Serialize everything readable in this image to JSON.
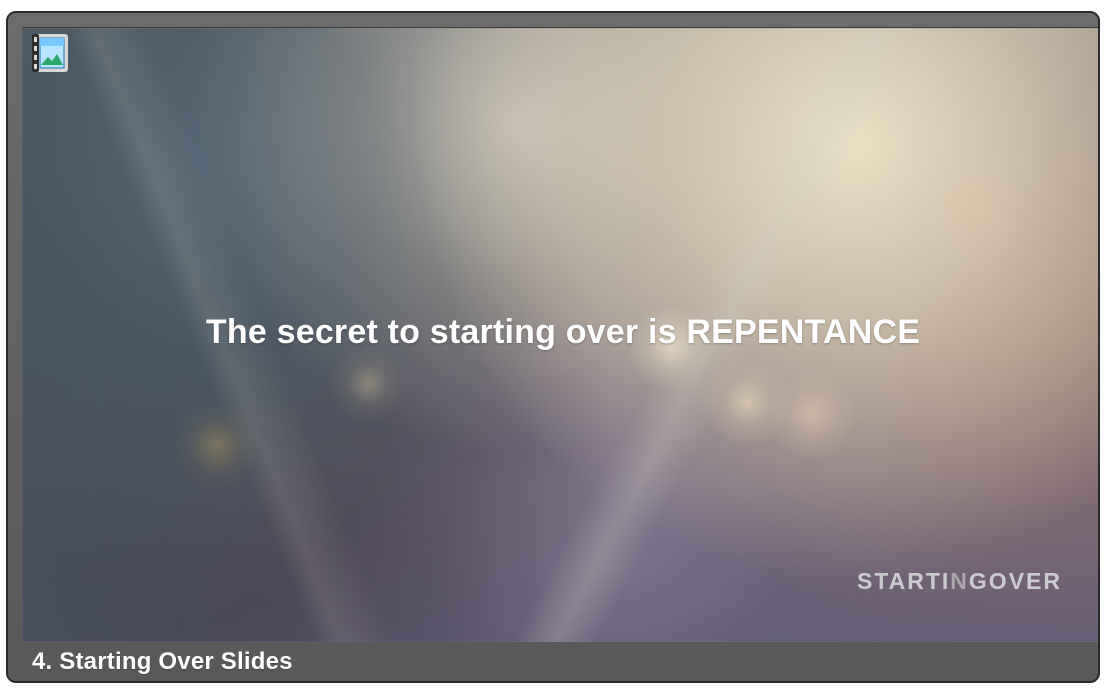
{
  "slide": {
    "headline": "The secret to starting over is REPENTANCE",
    "logo_text": {
      "left": "STARTI",
      "middle": "N",
      "right": "GOVER"
    },
    "caption": "4. Starting Over Slides"
  },
  "icons": {
    "slide_icon": "film-image-icon"
  }
}
